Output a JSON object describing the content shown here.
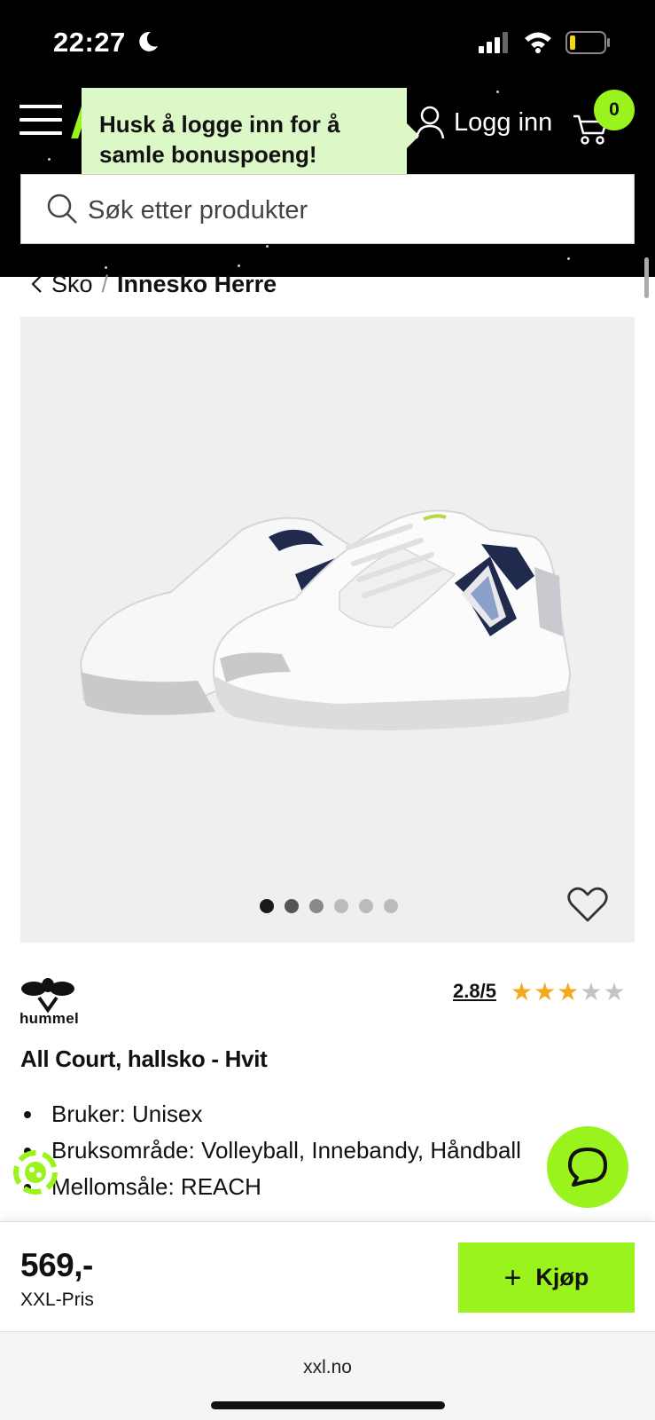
{
  "status_bar": {
    "time": "22:27"
  },
  "header": {
    "tooltip_text": "Husk å logge inn for å samle bonuspoeng!",
    "login_label": "Logg inn",
    "cart_count": "0",
    "search_placeholder": "Søk etter produkter"
  },
  "breadcrumb": {
    "items": [
      "Sko",
      "Innesko Herre"
    ],
    "separator": "/"
  },
  "product": {
    "image_count": 6,
    "active_image": 0,
    "brand": "hummel",
    "rating_label": "2.8/5",
    "rating_value": 2.8,
    "rating_max": 5,
    "title": "All Court, hallsko - Hvit",
    "features": [
      "Bruker: Unisex",
      "Bruksområde: Volleyball, Innebandy, Håndball",
      "Mellomsåle: REACH"
    ]
  },
  "buy_bar": {
    "price": "569,-",
    "price_label": "XXL-Pris",
    "buy_label": "Kjøp"
  },
  "browser": {
    "url": "xxl.no"
  },
  "colors": {
    "accent": "#9af31c",
    "tooltip_bg": "#dcf8c6",
    "header_bg": "#000000",
    "star_on": "#f3a81d",
    "star_off": "#c4c4c4"
  },
  "icons": [
    "moon-icon",
    "signal-icon",
    "wifi-icon",
    "battery-icon",
    "menu-icon",
    "user-icon",
    "cart-icon",
    "search-icon",
    "chevron-left-icon",
    "heart-icon",
    "star-icon",
    "plus-icon",
    "chat-icon",
    "eco-badge-icon",
    "hummel-logo-icon"
  ]
}
